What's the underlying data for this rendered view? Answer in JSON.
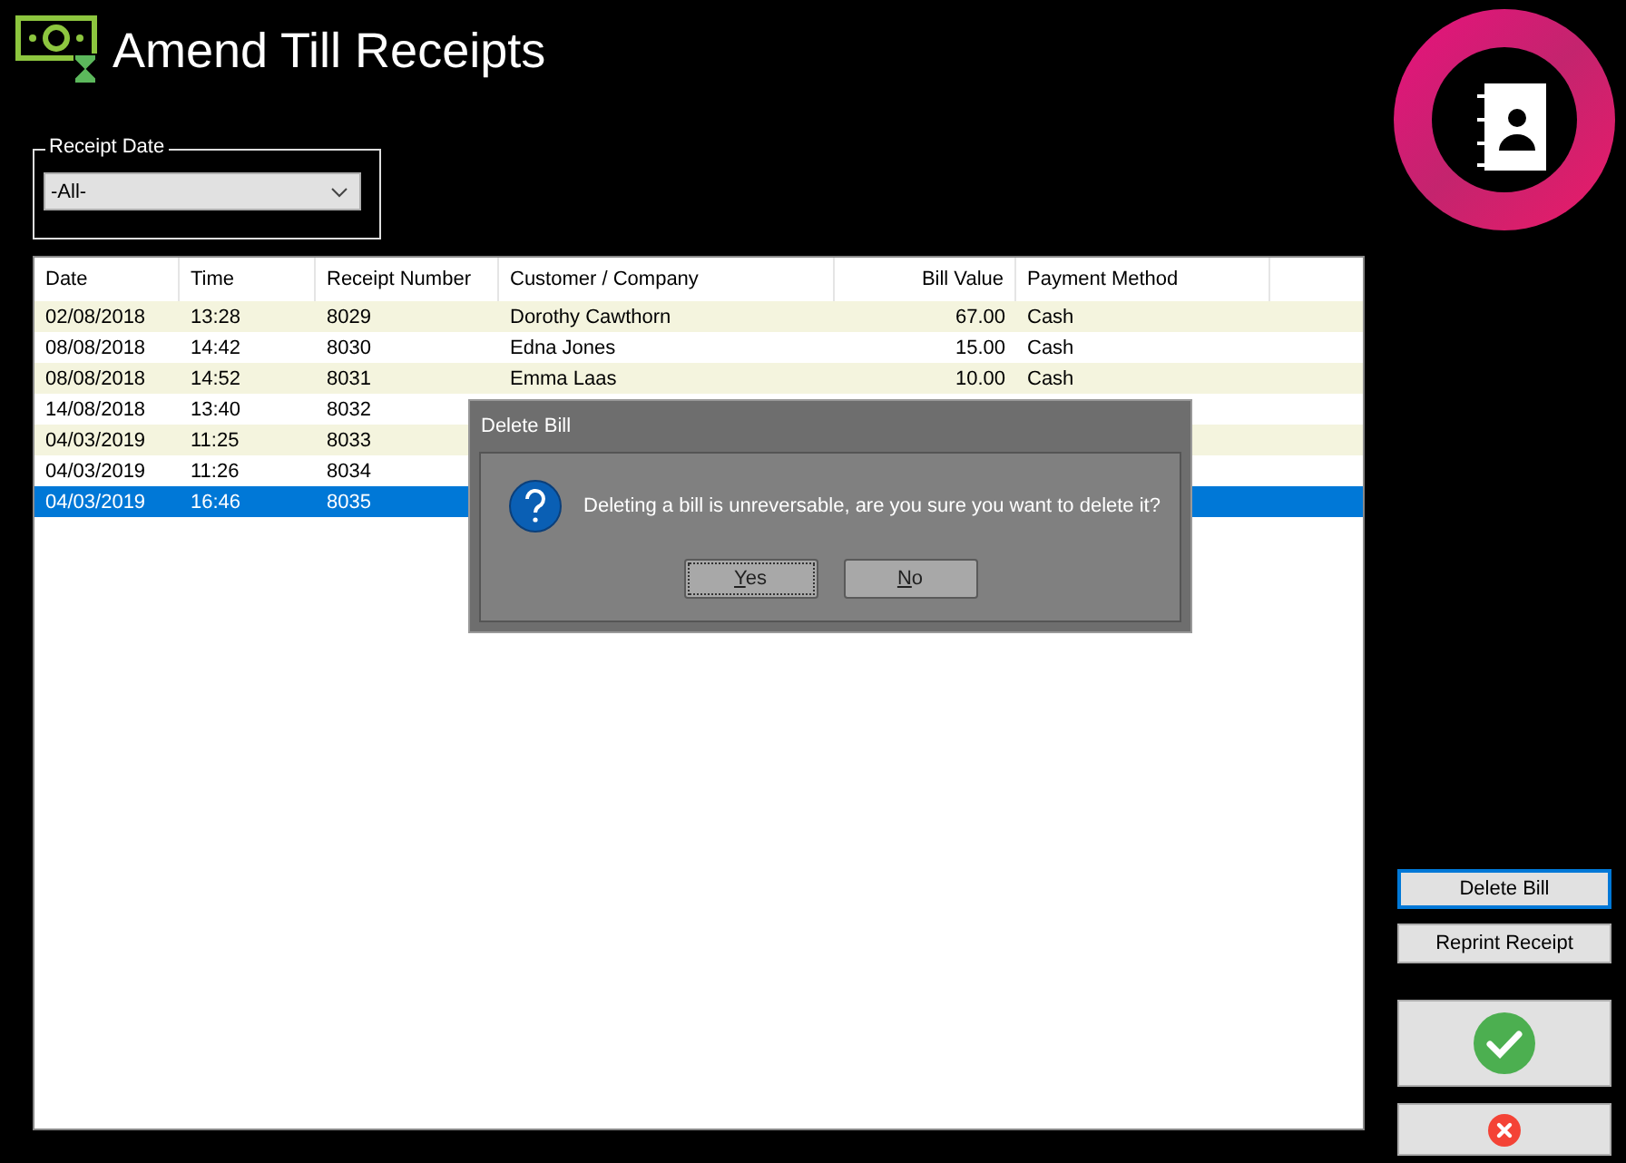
{
  "header": {
    "title": "Amend Till Receipts"
  },
  "filter": {
    "legend": "Receipt Date",
    "value": "-All-"
  },
  "table": {
    "columns": [
      {
        "label": "Date"
      },
      {
        "label": "Time"
      },
      {
        "label": "Receipt Number"
      },
      {
        "label": "Customer / Company"
      },
      {
        "label": "Bill Value"
      },
      {
        "label": "Payment Method"
      }
    ],
    "rows": [
      {
        "cells": [
          "02/08/2018",
          "13:28",
          "8029",
          "Dorothy Cawthorn",
          "67.00",
          "Cash"
        ],
        "selected": false
      },
      {
        "cells": [
          "08/08/2018",
          "14:42",
          "8030",
          "Edna Jones",
          "15.00",
          "Cash"
        ],
        "selected": false
      },
      {
        "cells": [
          "08/08/2018",
          "14:52",
          "8031",
          "Emma Laas",
          "10.00",
          "Cash"
        ],
        "selected": false
      },
      {
        "cells": [
          "14/08/2018",
          "13:40",
          "8032"
        ],
        "selected": false
      },
      {
        "cells": [
          "04/03/2019",
          "11:25",
          "8033"
        ],
        "selected": false
      },
      {
        "cells": [
          "04/03/2019",
          "11:26",
          "8034"
        ],
        "selected": false
      },
      {
        "cells": [
          "04/03/2019",
          "16:46",
          "8035"
        ],
        "selected": true
      }
    ]
  },
  "dialog": {
    "title": "Delete Bill",
    "message": "Deleting a bill is unreversable, are you sure you want to delete it?",
    "buttons": [
      {
        "label": "Yes",
        "focused": true
      },
      {
        "label": "No",
        "focused": false
      }
    ]
  },
  "actions": [
    {
      "kind": "text",
      "label": "Delete Bill",
      "focused": true
    },
    {
      "kind": "text",
      "label": "Reprint Receipt",
      "focused": false
    },
    {
      "kind": "confirm",
      "focused": false
    },
    {
      "kind": "cancel",
      "focused": false
    }
  ]
}
